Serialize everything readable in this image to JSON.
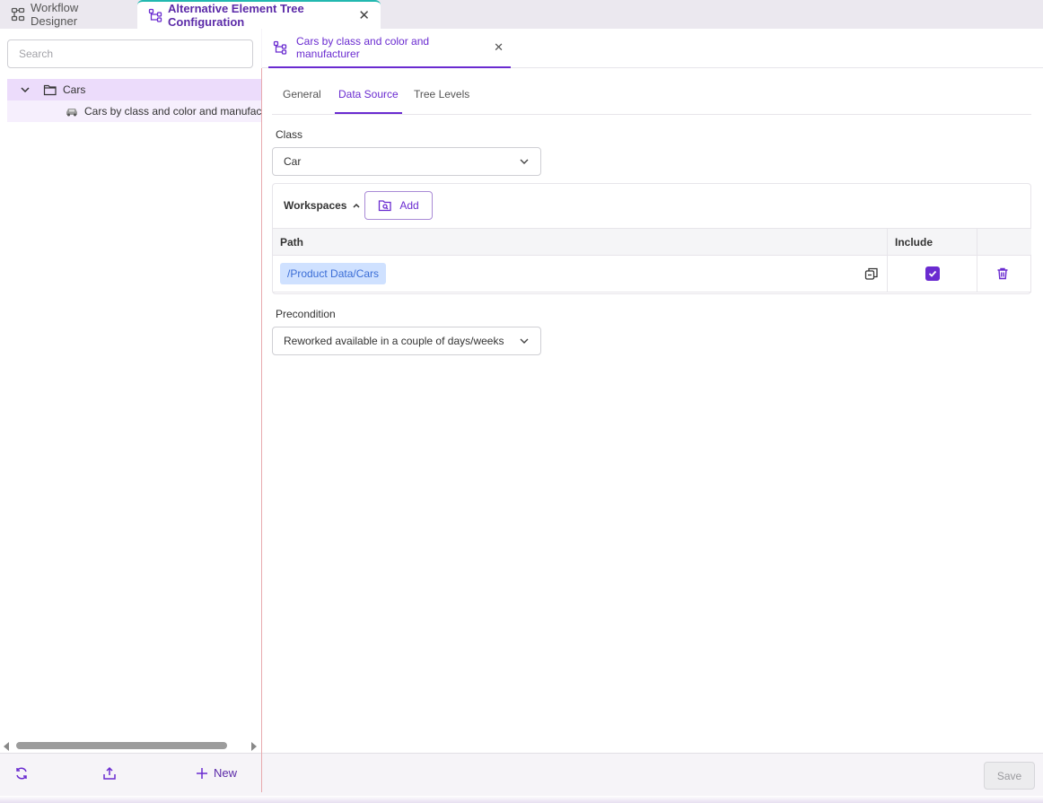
{
  "app_tabs": [
    {
      "label": "Workflow Designer",
      "icon": "workflow-icon",
      "active": false
    },
    {
      "label": "Alternative Element Tree Configuration",
      "icon": "tree-config-icon",
      "active": true,
      "closable": true
    }
  ],
  "left_panel": {
    "search": {
      "placeholder": "Search",
      "value": ""
    },
    "tree": [
      {
        "label": "Cars",
        "icon": "folder-icon",
        "expanded": true,
        "level": 0
      },
      {
        "label": "Cars by class and color and manufacturer",
        "icon": "car-icon",
        "level": 1,
        "selected": true
      }
    ],
    "footer": {
      "refresh_icon": "refresh-icon",
      "export_icon": "export-icon",
      "new_label": "New"
    }
  },
  "document_tab": {
    "label": "Cars by class and color and manufacturer",
    "icon": "tree-config-icon",
    "closable": true
  },
  "sub_tabs": [
    {
      "label": "General",
      "active": false
    },
    {
      "label": "Data Source",
      "active": true
    },
    {
      "label": "Tree Levels",
      "active": false
    }
  ],
  "data_source": {
    "class_label": "Class",
    "class_value": "Car",
    "workspaces": {
      "title": "Workspaces",
      "add_label": "Add",
      "columns": {
        "path": "Path",
        "include": "Include",
        "action": ""
      },
      "rows": [
        {
          "path": "/Product Data/Cars",
          "include": true
        }
      ]
    },
    "precondition_label": "Precondition",
    "precondition_value": "Reworked available in a couple of days/weeks"
  },
  "footer": {
    "save_label": "Save",
    "save_enabled": false
  },
  "colors": {
    "accent": "#6a2bd0",
    "tab_indicator": "#22b8b0",
    "tree_selected": "#ecdcfb",
    "path_chip": "#cfe1ff"
  }
}
